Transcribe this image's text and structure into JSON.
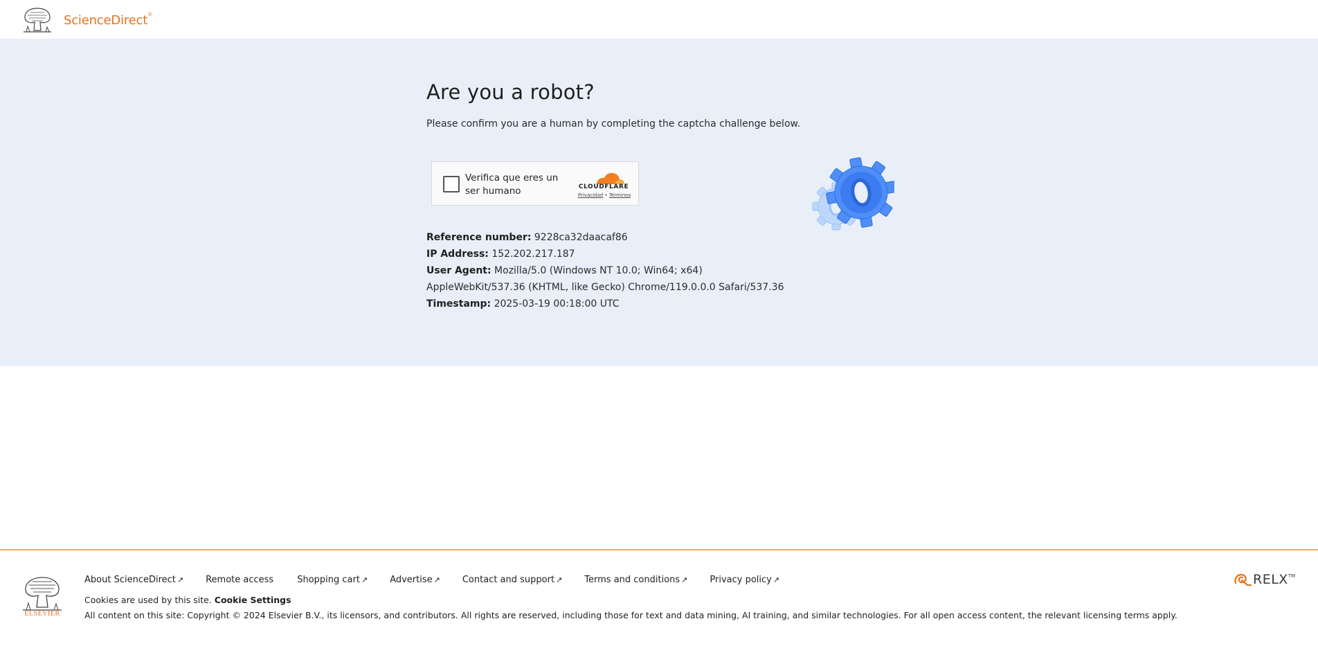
{
  "header": {
    "brand": "ScienceDirect",
    "brand_mark": "®",
    "logo_icon": "elsevier-tree-icon"
  },
  "main": {
    "title": "Are you a robot?",
    "subtitle": "Please confirm you are a human by completing the captcha challenge below.",
    "captcha": {
      "label": "Verifica que eres un ser humano",
      "provider": "CLOUDFLARE",
      "privacy_link": "Privacidad",
      "separator": "•",
      "terms_link": "Términos"
    },
    "info": [
      {
        "key": "Reference number:",
        "value": "9228ca32daacaf86"
      },
      {
        "key": "IP Address:",
        "value": "152.202.217.187"
      },
      {
        "key": "User Agent:",
        "value": "Mozilla/5.0 (Windows NT 10.0; Win64; x64) AppleWebKit/537.36 (KHTML, like Gecko) Chrome/119.0.0.0 Safari/537.36"
      },
      {
        "key": "Timestamp:",
        "value": "2025-03-19 00:18:00 UTC"
      }
    ]
  },
  "footer": {
    "logo_word": "ELSEVIER",
    "links": [
      {
        "label": "About ScienceDirect",
        "ext": "↗"
      },
      {
        "label": "Remote access",
        "ext": ""
      },
      {
        "label": "Shopping cart",
        "ext": "↗"
      },
      {
        "label": "Advertise",
        "ext": "↗"
      },
      {
        "label": "Contact and support",
        "ext": "↗"
      },
      {
        "label": "Terms and conditions",
        "ext": "↗"
      },
      {
        "label": "Privacy policy",
        "ext": "↗"
      }
    ],
    "cookies_text": "Cookies are used by this site.",
    "cookie_settings": "Cookie Settings",
    "copyright": "All content on this site: Copyright © 2024 Elsevier B.V., its licensors, and contributors. All rights are reserved, including those for text and data mining, AI training, and similar technologies. For all open access content, the relevant licensing terms apply.",
    "relx_word": "RELX",
    "relx_tm": "TM"
  },
  "colors": {
    "accent": "#e9711c",
    "hero_bg": "#e8eff8",
    "gear_blue": "#3b82f6"
  }
}
